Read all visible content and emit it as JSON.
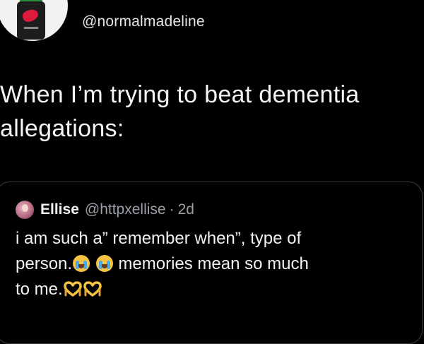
{
  "tweet": {
    "author_handle": "@normalmadeline",
    "text": "When I’m trying to beat dementia\nallegations:"
  },
  "quote": {
    "name": "Ellise",
    "handle": "@httpxellise",
    "separator": "·",
    "time": "2d",
    "body_line1": "i am such a” remember when”, type of",
    "body_line2_a": "person.",
    "body_line2_b": " memories mean so much",
    "body_line3": "to me.",
    "emojis": [
      "loudly-crying-face",
      "loudly-crying-face",
      "heart-hands",
      "heart-hands"
    ]
  },
  "colors": {
    "background": "#000000",
    "text": "#f5f5f5",
    "secondary_text": "#9aa0a6",
    "card_border": "#3a3f44",
    "emoji_face": "#f5c242",
    "heart_hands": "#f5c242"
  }
}
